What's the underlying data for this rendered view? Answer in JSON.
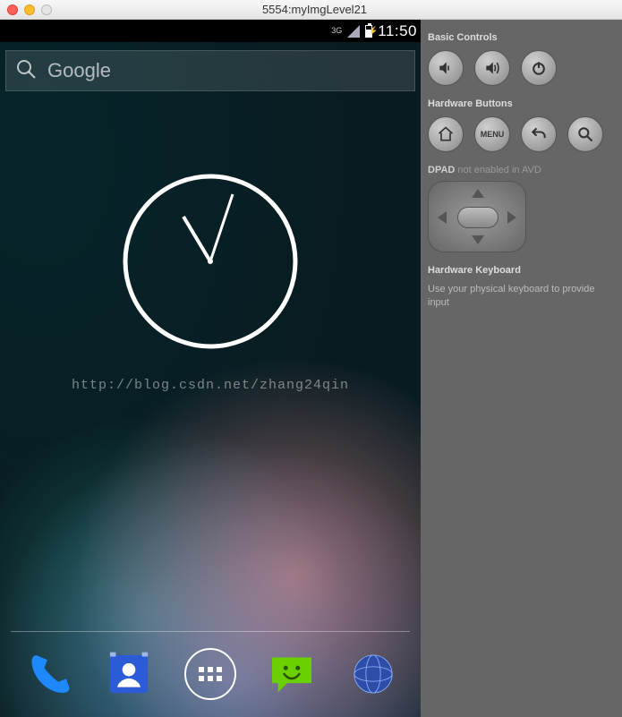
{
  "window": {
    "title": "5554:myImgLevel21"
  },
  "statusbar": {
    "network": "3G",
    "time": "11:50"
  },
  "search": {
    "placeholder": "Google"
  },
  "watermark": "http://blog.csdn.net/zhang24qin",
  "dock": {
    "items": [
      {
        "name": "phone-app-icon"
      },
      {
        "name": "contacts-app-icon"
      },
      {
        "name": "all-apps-icon"
      },
      {
        "name": "messaging-app-icon"
      },
      {
        "name": "browser-app-icon"
      }
    ]
  },
  "panel": {
    "basic_label": "Basic Controls",
    "hardware_label": "Hardware Buttons",
    "menu_label": "MENU",
    "dpad_label": "DPAD",
    "dpad_note": "not enabled in AVD",
    "keyboard_label": "Hardware Keyboard",
    "keyboard_note": "Use your physical keyboard to provide input"
  }
}
